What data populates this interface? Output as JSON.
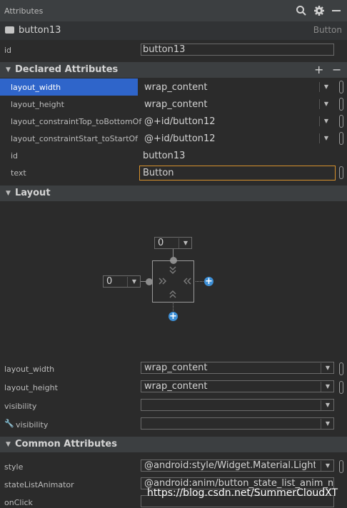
{
  "panel": {
    "title": "Attributes",
    "icons": [
      "search-icon",
      "gear-icon",
      "minimize-icon"
    ]
  },
  "component": {
    "name": "button13",
    "type": "Button"
  },
  "id_field": {
    "label": "id",
    "value": "button13"
  },
  "declared": {
    "title": "Declared Attributes",
    "add_symbol": "+",
    "remove_symbol": "−",
    "rows": [
      {
        "label": "layout_width",
        "value": "wrap_content"
      },
      {
        "label": "layout_height",
        "value": "wrap_content"
      },
      {
        "label": "layout_constraintTop_toBottomOf",
        "value": "@+id/button12"
      },
      {
        "label": "layout_constraintStart_toStartOf",
        "value": "@+id/button12"
      },
      {
        "label": "id",
        "value": "button13"
      },
      {
        "label": "text",
        "value": "Button"
      }
    ]
  },
  "layout": {
    "title": "Layout",
    "top_margin": "0",
    "start_margin": "0",
    "rows": [
      {
        "label": "layout_width",
        "value": "wrap_content"
      },
      {
        "label": "layout_height",
        "value": "wrap_content"
      },
      {
        "label": "visibility",
        "value": ""
      },
      {
        "label": "visibility",
        "value": ""
      }
    ]
  },
  "common": {
    "title": "Common Attributes",
    "rows": [
      {
        "label": "style",
        "value": "@android:style/Widget.Material.Light.I"
      },
      {
        "label": "stateListAnimator",
        "value": "@android:anim/button_state_list_anim_mate"
      },
      {
        "label": "onClick",
        "value": ""
      }
    ]
  },
  "watermark": "https://blog.csdn.net/SummerCloudXT",
  "colors": {
    "selection": "#2f65ca",
    "focus_border": "#d7922d",
    "plus_blue": "#3d8fd6"
  }
}
